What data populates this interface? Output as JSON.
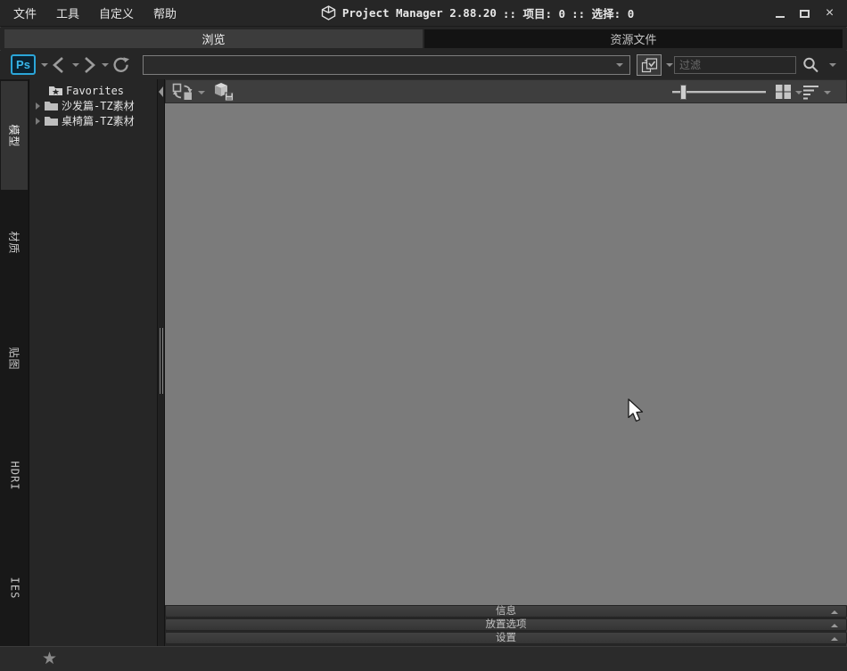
{
  "titlebar": {
    "menu_items": [
      "文件",
      "工具",
      "自定义",
      "帮助"
    ],
    "app_title": "Project Manager 2.88.20",
    "project_info": ":: 项目: 0",
    "selection_info": ":: 选择: 0",
    "close_glyph": "×"
  },
  "tabs": {
    "browse": "浏览",
    "resources": "资源文件"
  },
  "toolbar": {
    "ps_label": "Ps",
    "address_value": "",
    "filter_placeholder": "过滤"
  },
  "sidebar_tabs": [
    "模型",
    "材质",
    "贴图",
    "HDRI",
    "IES"
  ],
  "tree_items": [
    {
      "label": "Favorites"
    },
    {
      "label": "沙发篇-TZ素材"
    },
    {
      "label": "桌椅篇-TZ素材"
    }
  ],
  "bottom_panels": [
    "信息",
    "放置选项",
    "设置"
  ],
  "statusbar": {
    "favorite_glyph": "★"
  },
  "icons": {
    "logo": "cube-logo",
    "back": "chevron-left",
    "forward": "chevron-right",
    "refresh": "reload",
    "stack": "layers-check",
    "search": "magnifier",
    "swap": "replace-arrows",
    "cube_save": "save-model",
    "grid": "grid-view",
    "sort": "sort-lines",
    "folder": "folder",
    "favorites_folder": "folder-star",
    "cursor": "arrow-pointer"
  },
  "colors": {
    "chrome": "#262626",
    "tab_active": "#3c3c3c",
    "tab_inactive": "#131313",
    "content_toolbar": "#3e3e3e",
    "canvas": "#7b7b7b",
    "ps_accent": "#2ba6d9",
    "statusbar": "#2b2b2b"
  }
}
